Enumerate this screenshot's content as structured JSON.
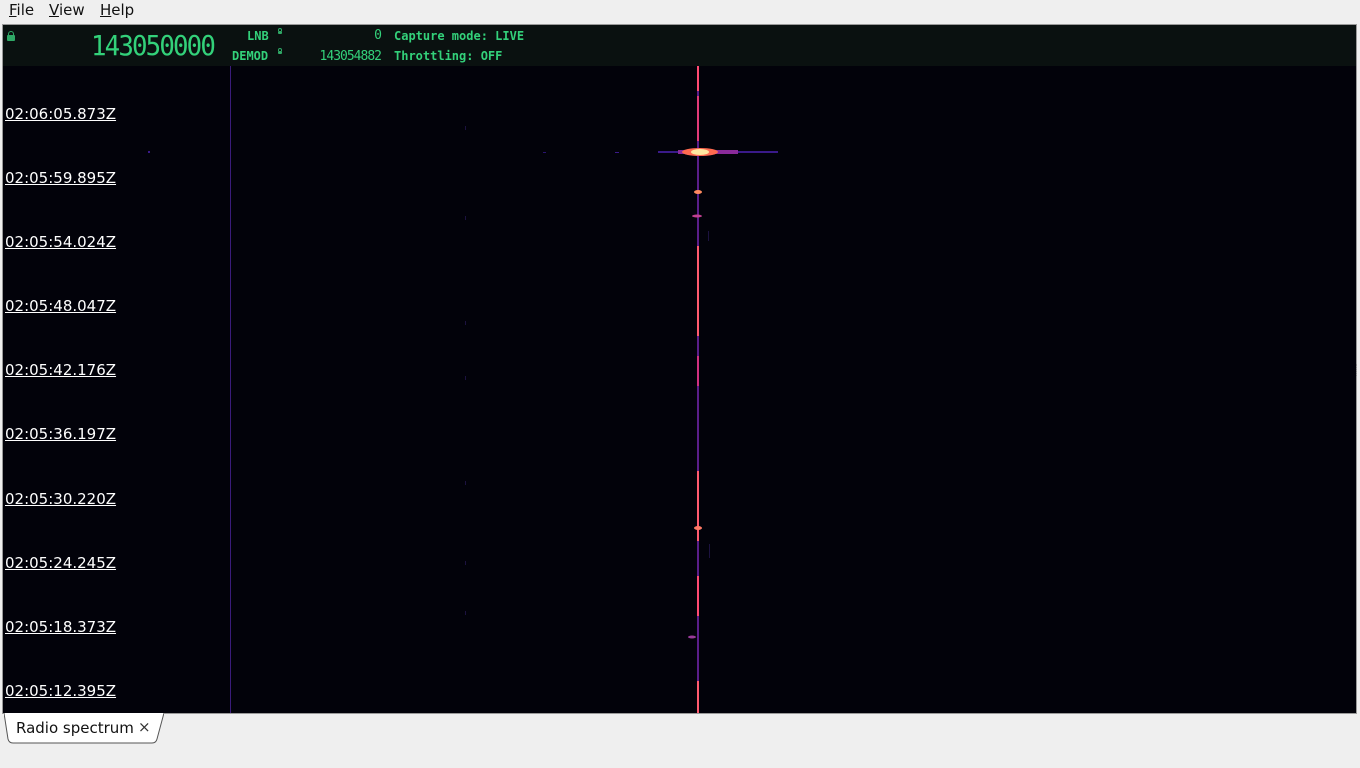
{
  "menu": {
    "items": [
      {
        "mnemonic": "F",
        "rest": "ile"
      },
      {
        "mnemonic": "V",
        "rest": "iew"
      },
      {
        "mnemonic": "H",
        "rest": "elp"
      }
    ]
  },
  "header": {
    "main_frequency": "143050000",
    "lnb_label": "LNB",
    "lnb_value": "0",
    "demod_label": "DEMOD",
    "demod_value": "143054882",
    "capture_mode": "Capture mode: LIVE",
    "throttling": "Throttling: OFF"
  },
  "waterfall": {
    "timestamps": [
      "02:06:05.873Z",
      "02:05:59.895Z",
      "02:05:54.024Z",
      "02:05:48.047Z",
      "02:05:42.176Z",
      "02:05:36.197Z",
      "02:05:30.220Z",
      "02:05:24.245Z",
      "02:05:18.373Z",
      "02:05:12.395Z"
    ]
  },
  "tabs": [
    {
      "label": "Radio spectrum",
      "close": "×"
    }
  ],
  "colors": {
    "header_text": "#33d17a",
    "waterfall_bg": "#02020a",
    "signal_core": "#ff5a6e",
    "signal_hot": "#ffe8a0",
    "signal_faint": "#5a1ea0"
  }
}
